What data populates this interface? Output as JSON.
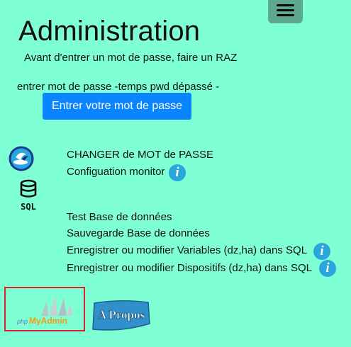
{
  "menu": {
    "icon": "hamburger-icon"
  },
  "header": {
    "title": "Administration",
    "subtitle": "Avant d'entrer un mot de passe, faire un RAZ"
  },
  "password": {
    "status": "entrer mot de passe -temps pwd dépassé -",
    "button_label": "Entrer votre mot de passe"
  },
  "links": {
    "change_password": "CHANGER de MOT de PASSE",
    "config_monitor": "Configuation monitor",
    "test_db": "Test Base de données",
    "backup_db": "Sauvegarde Base de données",
    "variables_sql": "Enregistrer ou modifier Variables (dz,ha) dans SQL",
    "devices_sql": "Enregistrer ou modifier Dispositifs (dz,ha) dans SQL"
  },
  "icons": {
    "info": "i",
    "sql_label": "SQL"
  },
  "footer": {
    "phpmyadmin_prefix": "php",
    "phpmyadmin_name": "MyAdmin",
    "about_label": "A Propos"
  },
  "colors": {
    "background": "#7fffd4",
    "primary_button": "#0b84ff",
    "info_icon": "#29a6dc",
    "menu_button": "#5fa890",
    "highlight_border": "#d9252a",
    "about_badge": "#2f90cc"
  }
}
